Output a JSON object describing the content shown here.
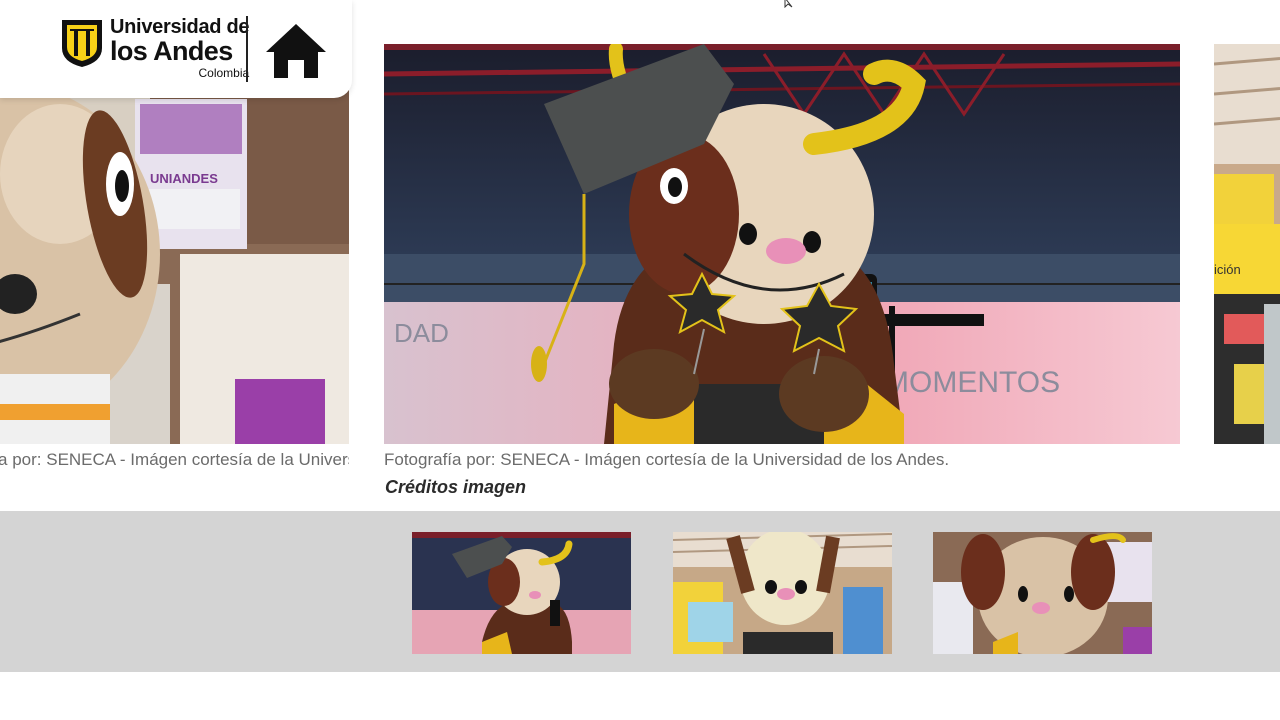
{
  "logo": {
    "line1": "Universidad de",
    "line2": "los Andes",
    "line3": "Colombia",
    "brand_color": "#f7d117"
  },
  "header": {
    "home_icon": "home-icon"
  },
  "slides": {
    "left_caption": "Fotografía por: SENECA - Imágen cortesía de la Universidad de los Andes.",
    "main_caption": "Fotografía por: SENECA - Imágen cortesía de la Universidad de los Andes.",
    "credits_label": "Créditos imagen"
  },
  "background_signs": {
    "left_poster": "UNIANDES",
    "main_wall_left": "DAD",
    "main_wall_right": "MOMENTOS",
    "right_sign": "ición"
  },
  "thumbnails": [
    {
      "name": "mascot-graduation"
    },
    {
      "name": "mascot-bookstore"
    },
    {
      "name": "mascot-campus"
    }
  ],
  "colors": {
    "thumb_strip": "#d4d4d4",
    "caption": "#6b6b6b",
    "credits": "#2b2b2b"
  }
}
